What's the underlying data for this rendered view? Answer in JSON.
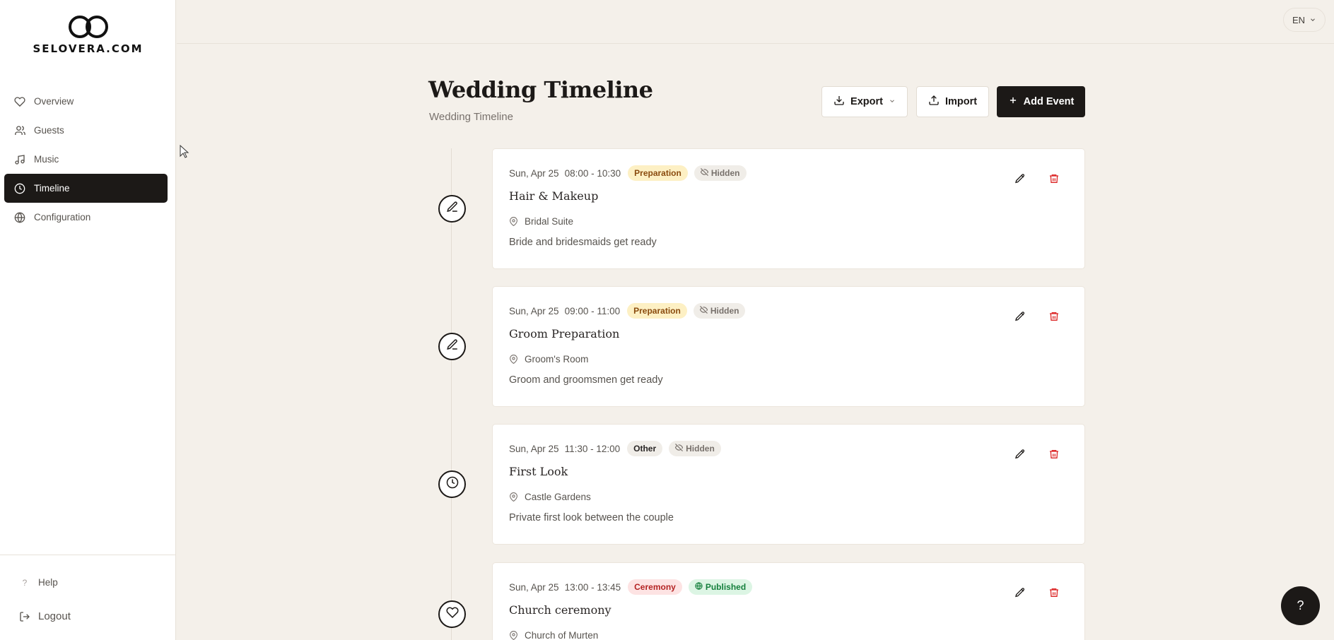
{
  "brand": {
    "logo_text": "SELOVERA.COM"
  },
  "sidebar": {
    "items": [
      {
        "label": "Overview",
        "icon": "heart-icon"
      },
      {
        "label": "Guests",
        "icon": "users-icon"
      },
      {
        "label": "Music",
        "icon": "music-icon"
      },
      {
        "label": "Timeline",
        "icon": "clock-icon",
        "active": true
      },
      {
        "label": "Configuration",
        "icon": "globe-icon"
      }
    ],
    "help_label": "Help",
    "logout_label": "Logout"
  },
  "topbar": {
    "language": "EN"
  },
  "page": {
    "title": "Wedding Timeline",
    "subtitle": "Wedding Timeline",
    "export_label": "Export",
    "import_label": "Import",
    "add_event_label": "Add Event"
  },
  "events": [
    {
      "date": "Sun, Apr 25",
      "time": "08:00 - 10:30",
      "category": "Preparation",
      "visibility": "Hidden",
      "title": "Hair & Makeup",
      "location": "Bridal Suite",
      "description": "Bride and bridesmaids get ready",
      "icon": "pen-icon"
    },
    {
      "date": "Sun, Apr 25",
      "time": "09:00 - 11:00",
      "category": "Preparation",
      "visibility": "Hidden",
      "title": "Groom Preparation",
      "location": "Groom's Room",
      "description": "Groom and groomsmen get ready",
      "icon": "pen-icon"
    },
    {
      "date": "Sun, Apr 25",
      "time": "11:30 - 12:00",
      "category": "Other",
      "visibility": "Hidden",
      "title": "First Look",
      "location": "Castle Gardens",
      "description": "Private first look between the couple",
      "icon": "clock-icon"
    },
    {
      "date": "Sun, Apr 25",
      "time": "13:00 - 13:45",
      "category": "Ceremony",
      "visibility": "Published",
      "title": "Church ceremony",
      "location": "Church of Murten",
      "description": "",
      "icon": "heart-icon"
    }
  ],
  "help_fab": "?",
  "colors": {
    "accent_dark": "#1c1917",
    "background": "#f4f0ea",
    "delete_red": "#dc2626"
  }
}
